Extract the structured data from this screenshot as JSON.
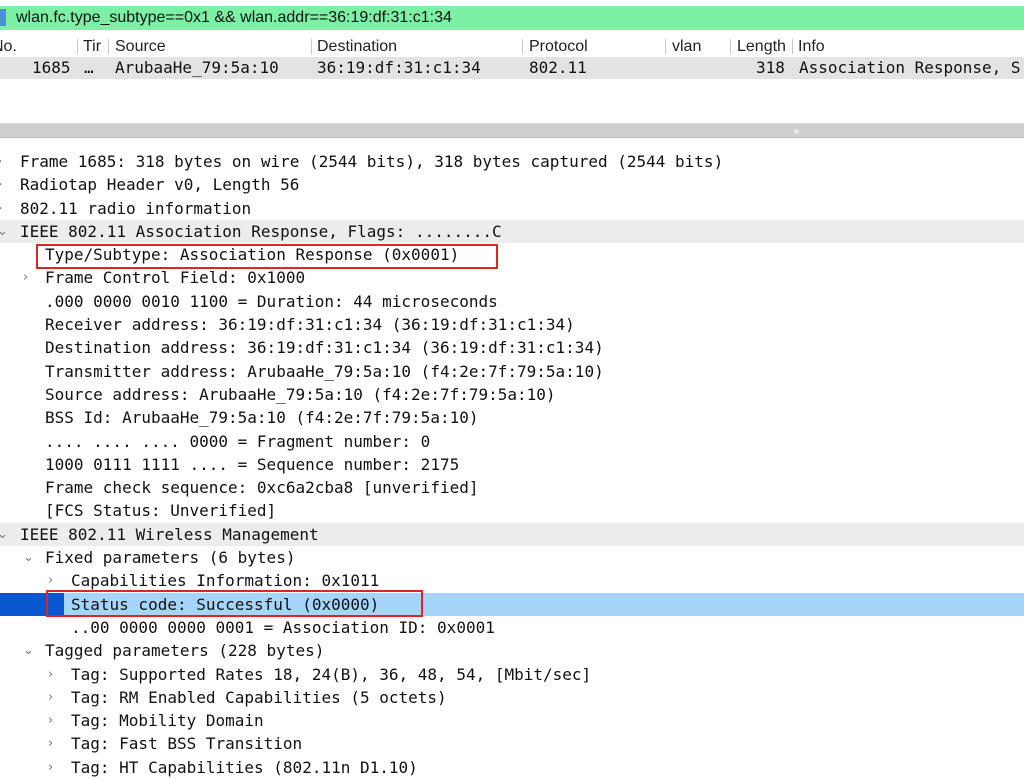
{
  "filter": {
    "value": "wlan.fc.type_subtype==0x1 && wlan.addr==36:19:df:31:c1:34"
  },
  "packet_list": {
    "columns": [
      "No.",
      "Tir",
      "Source",
      "Destination",
      "Protocol",
      "vlan",
      "Length",
      "Info"
    ],
    "rows": [
      {
        "no": "1685",
        "time": "…",
        "source": "ArubaaHe_79:5a:10",
        "destination": "36:19:df:31:c1:34",
        "protocol": "802.11",
        "vlan": "",
        "length": "318",
        "info": "Association Response, S"
      }
    ]
  },
  "detail": {
    "rows": [
      {
        "arrow": "›",
        "text": "Frame 1685: 318 bytes on wire (2544 bits), 318 bytes captured (2544 bits)"
      },
      {
        "arrow": "›",
        "text": "Radiotap Header v0, Length 56"
      },
      {
        "arrow": "›",
        "text": "802.11 radio information"
      },
      {
        "arrow": "⌄",
        "text": "IEEE 802.11 Association Response, Flags: ........C"
      },
      {
        "arrow": "",
        "text": "Type/Subtype: Association Response (0x0001)"
      },
      {
        "arrow": "›",
        "text": "Frame Control Field: 0x1000"
      },
      {
        "arrow": "",
        "text": ".000 0000 0010 1100 = Duration: 44 microseconds"
      },
      {
        "arrow": "",
        "text": "Receiver address: 36:19:df:31:c1:34 (36:19:df:31:c1:34)"
      },
      {
        "arrow": "",
        "text": "Destination address: 36:19:df:31:c1:34 (36:19:df:31:c1:34)"
      },
      {
        "arrow": "",
        "text": "Transmitter address: ArubaaHe_79:5a:10 (f4:2e:7f:79:5a:10)"
      },
      {
        "arrow": "",
        "text": "Source address: ArubaaHe_79:5a:10 (f4:2e:7f:79:5a:10)"
      },
      {
        "arrow": "",
        "text": "BSS Id: ArubaaHe_79:5a:10 (f4:2e:7f:79:5a:10)"
      },
      {
        "arrow": "",
        "text": ".... .... .... 0000 = Fragment number: 0"
      },
      {
        "arrow": "",
        "text": "1000 0111 1111 .... = Sequence number: 2175"
      },
      {
        "arrow": "",
        "text": "Frame check sequence: 0xc6a2cba8 [unverified]"
      },
      {
        "arrow": "",
        "text": "[FCS Status: Unverified]"
      },
      {
        "arrow": "⌄",
        "text": "IEEE 802.11 Wireless Management"
      },
      {
        "arrow": "⌄",
        "text": "Fixed parameters (6 bytes)"
      },
      {
        "arrow": "›",
        "text": "Capabilities Information: 0x1011"
      },
      {
        "arrow": "",
        "text": "Status code: Successful (0x0000)"
      },
      {
        "arrow": "",
        "text": "..00 0000 0000 0001 = Association ID: 0x0001"
      },
      {
        "arrow": "⌄",
        "text": "Tagged parameters (228 bytes)"
      },
      {
        "arrow": "›",
        "text": "Tag: Supported Rates 18, 24(B), 36, 48, 54, [Mbit/sec]"
      },
      {
        "arrow": "›",
        "text": "Tag: RM Enabled Capabilities (5 octets)"
      },
      {
        "arrow": "›",
        "text": "Tag: Mobility Domain"
      },
      {
        "arrow": "›",
        "text": "Tag: Fast BSS Transition"
      },
      {
        "arrow": "›",
        "text": "Tag: HT Capabilities (802.11n D1.10)"
      }
    ]
  }
}
